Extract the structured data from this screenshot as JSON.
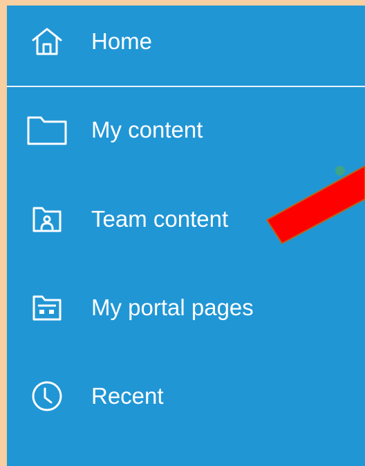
{
  "colors": {
    "outer_background": "#f8cfa0",
    "panel_background": "#2196d5",
    "text": "#ffffff",
    "divider": "#e9f4fb",
    "annotation_arrow": "#ff0000"
  },
  "nav": {
    "items": [
      {
        "label": "Home",
        "icon": "home-icon"
      },
      {
        "label": "My content",
        "icon": "folder-icon"
      },
      {
        "label": "Team content",
        "icon": "team-folder-icon"
      },
      {
        "label": "My portal pages",
        "icon": "portal-pages-icon"
      },
      {
        "label": "Recent",
        "icon": "clock-icon"
      }
    ]
  }
}
